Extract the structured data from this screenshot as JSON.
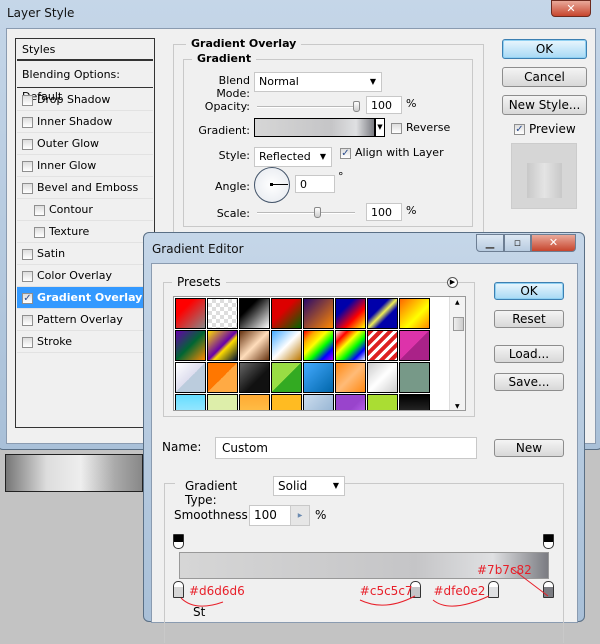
{
  "layer_style": {
    "title": "Layer Style",
    "styles_header": "Styles",
    "blending": "Blending Options: Default",
    "items": [
      {
        "label": "Drop Shadow",
        "checked": false,
        "indent": false
      },
      {
        "label": "Inner Shadow",
        "checked": false,
        "indent": false
      },
      {
        "label": "Outer Glow",
        "checked": false,
        "indent": false
      },
      {
        "label": "Inner Glow",
        "checked": false,
        "indent": false
      },
      {
        "label": "Bevel and Emboss",
        "checked": false,
        "indent": false
      },
      {
        "label": "Contour",
        "checked": false,
        "indent": true
      },
      {
        "label": "Texture",
        "checked": false,
        "indent": true
      },
      {
        "label": "Satin",
        "checked": false,
        "indent": false
      },
      {
        "label": "Color Overlay",
        "checked": false,
        "indent": false
      },
      {
        "label": "Gradient Overlay",
        "checked": true,
        "indent": false,
        "selected": true
      },
      {
        "label": "Pattern Overlay",
        "checked": false,
        "indent": false
      },
      {
        "label": "Stroke",
        "checked": false,
        "indent": false
      }
    ],
    "section_title": "Gradient Overlay",
    "group_title": "Gradient",
    "blend_mode_label": "Blend Mode:",
    "blend_mode": "Normal",
    "opacity_label": "Opacity:",
    "opacity": "100",
    "opacity_unit": "%",
    "gradient_label": "Gradient:",
    "reverse_label": "Reverse",
    "reverse_checked": false,
    "style_label": "Style:",
    "style": "Reflected",
    "align_label": "Align with Layer",
    "align_checked": true,
    "angle_label": "Angle:",
    "angle": "0",
    "angle_unit": "°",
    "scale_label": "Scale:",
    "scale": "100",
    "scale_unit": "%",
    "ok": "OK",
    "cancel": "Cancel",
    "new_style": "New Style...",
    "preview_label": "Preview",
    "preview_checked": true
  },
  "gradient_editor": {
    "title": "Gradient Editor",
    "presets_label": "Presets",
    "ok": "OK",
    "reset": "Reset",
    "load": "Load...",
    "save": "Save...",
    "name_label": "Name:",
    "name_value": "Custom",
    "new": "New",
    "type_label": "Gradient Type:",
    "type_value": "Solid",
    "smoothness_label": "Smoothness:",
    "smoothness": "100",
    "smoothness_unit": "%",
    "stops": [
      {
        "color": "#d6d6d6",
        "label": "#d6d6d6",
        "location": 0
      },
      {
        "color": "#c5c5c7",
        "label": "#c5c5c7",
        "location": 64
      },
      {
        "color": "#dfe0e2",
        "label": "#dfe0e2",
        "location": 85
      },
      {
        "color": "#7b7c82",
        "label": "#7b7c82",
        "location": 100
      }
    ],
    "cut_label": "St"
  }
}
